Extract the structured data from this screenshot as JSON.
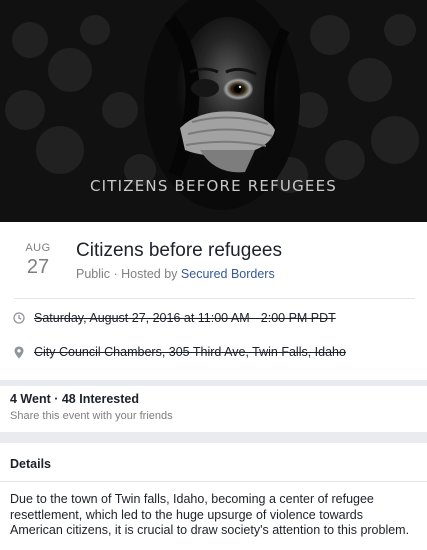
{
  "cover": {
    "caption": "CITIZENS BEFORE REFUGEES"
  },
  "event": {
    "month": "AUG",
    "day": "27",
    "title": "Citizens before refugees",
    "privacy": "Public · Hosted by ",
    "host": "Secured Borders",
    "time": "Saturday, August 27, 2016 at 11:00 AM - 2:00 PM PDT",
    "place": "City Council Chambers, 305 Third Ave, Twin Falls, Idaho"
  },
  "attendance": {
    "counts": "4 Went · 48 Interested",
    "share": "Share this event with your friends"
  },
  "details": {
    "heading": "Details",
    "body": "Due to the town of Twin falls, Idaho, becoming a center of refugee resettlement, which led to the huge upsurge of violence towards American citizens, it is crucial to draw society's attention to this problem."
  },
  "icons": {
    "time": "clock-icon",
    "place": "location-pin-icon"
  },
  "colors": {
    "link": "#365899",
    "muted": "#7f7f7f",
    "text": "#1d2129",
    "page_bg": "#e9ebee"
  }
}
